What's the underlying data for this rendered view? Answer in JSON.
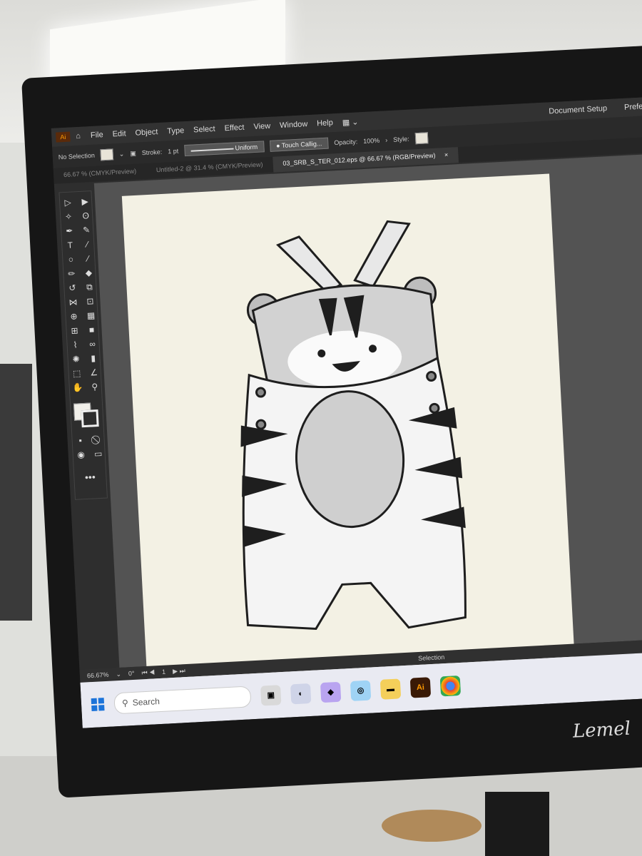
{
  "menubar": {
    "app_badge": "Ai",
    "items": [
      "File",
      "Edit",
      "Object",
      "Type",
      "Select",
      "Effect",
      "View",
      "Window",
      "Help"
    ],
    "document_setup": "Document Setup",
    "preferences": "Preferen"
  },
  "control_bar": {
    "selection_label": "No Selection",
    "stroke_label": "Stroke:",
    "stroke_value": "1 pt",
    "profile": "Uniform",
    "brush": "Touch Callig...",
    "opacity_label": "Opacity:",
    "opacity_value": "100%",
    "style_label": "Style:"
  },
  "tabs": [
    {
      "label": "66.67 % (CMYK/Preview)",
      "active": false
    },
    {
      "label": "Untitled-2 @ 31.4 % (CMYK/Preview)",
      "active": false
    },
    {
      "label": "03_SRB_S_TER_012.eps @ 66.67 % (RGB/Preview)",
      "active": true
    }
  ],
  "tab_close": "×",
  "status_bar": {
    "zoom": "66.67%",
    "rotation": "0°",
    "artboard": "1",
    "tool": "Selection"
  },
  "taskbar": {
    "search_placeholder": "Search",
    "illustrator_label": "Ai"
  },
  "monitor_brand": "Lemel",
  "colors": {
    "artboard": "#f3f1e4",
    "ui_dark": "#2e2e2e",
    "accent_ai": "#ff9a00"
  }
}
